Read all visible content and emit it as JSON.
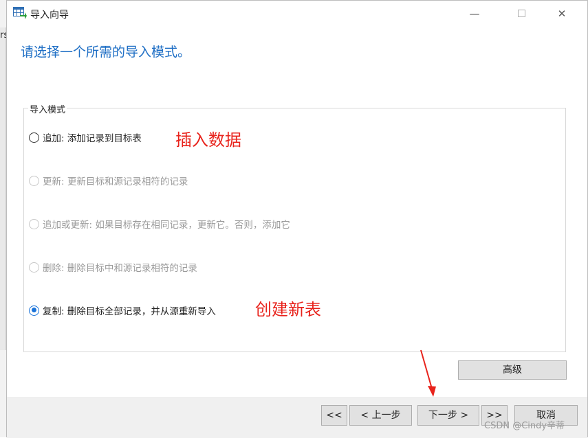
{
  "background": {
    "left_text": "rs"
  },
  "window": {
    "title": "导入向导",
    "minimize_glyph": "—",
    "close_glyph": "✕"
  },
  "heading": "请选择一个所需的导入模式。",
  "import_mode": {
    "group_label": "导入模式",
    "options": [
      {
        "label": "追加: 添加记录到目标表",
        "enabled": true,
        "checked": false
      },
      {
        "label": "更新: 更新目标和源记录相符的记录",
        "enabled": false,
        "checked": false
      },
      {
        "label": "追加或更新: 如果目标存在相同记录，更新它。否则，添加它",
        "enabled": false,
        "checked": false
      },
      {
        "label": "删除: 删除目标中和源记录相符的记录",
        "enabled": false,
        "checked": false
      },
      {
        "label": "复制: 删除目标全部记录，并从源重新导入",
        "enabled": true,
        "checked": true
      }
    ]
  },
  "annotations": {
    "insert": "插入数据",
    "create": "创建新表"
  },
  "buttons": {
    "advanced": "高级",
    "first": "<<",
    "prev": "< 上一步",
    "next": "下一步 >",
    "last": ">>",
    "cancel": "取消"
  },
  "watermark": "CSDN @Cindy辛蒂",
  "colors": {
    "heading": "#1f6fc5",
    "annotation": "#e8231c",
    "radio_selected": "#1a73d9"
  }
}
